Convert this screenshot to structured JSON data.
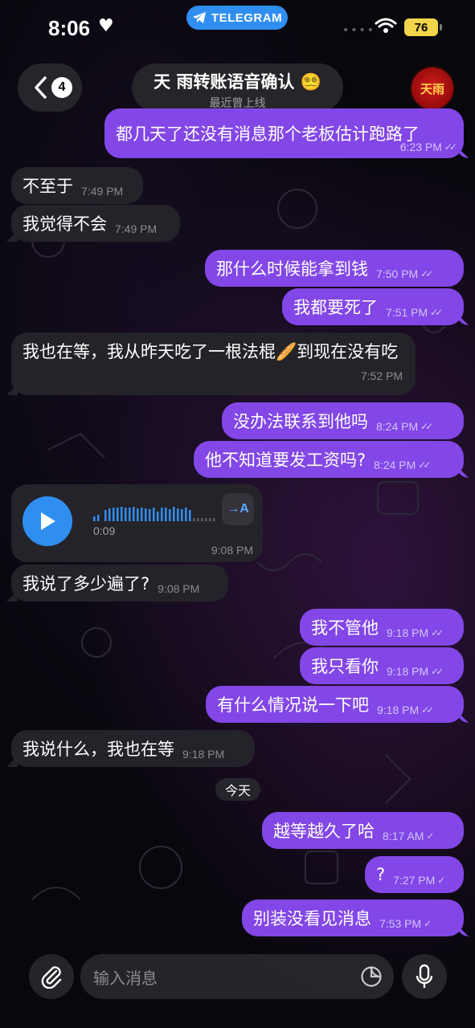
{
  "status_bar": {
    "time": "8:06",
    "app_pill": "TELEGRAM",
    "battery": "76"
  },
  "header": {
    "back_count": "4",
    "title": "天 雨转账语音确认",
    "title_emoji": "😵‍💫",
    "subtitle": "最近曾上线",
    "avatar_text": "天雨"
  },
  "messages": [
    {
      "dir": "out",
      "text": "都几天了还没有消息那个老板估计跑路了",
      "time": "6:23 PM",
      "read": true
    },
    {
      "dir": "in",
      "text": "不至于",
      "time": "7:49 PM"
    },
    {
      "dir": "in",
      "text": "我觉得不会",
      "time": "7:49 PM"
    },
    {
      "dir": "out",
      "text": "那什么时候能拿到钱",
      "time": "7:50 PM",
      "read": true
    },
    {
      "dir": "out",
      "text": "我都要死了",
      "time": "7:51 PM",
      "read": true
    },
    {
      "dir": "in",
      "text": "我也在等，我从昨天吃了一根法棍🥖到现在没有吃",
      "time": "7:52 PM"
    },
    {
      "dir": "out",
      "text": "没办法联系到他吗",
      "time": "8:24 PM",
      "read": true
    },
    {
      "dir": "out",
      "text": "他不知道要发工资吗?",
      "time": "8:24 PM",
      "read": true
    },
    {
      "dir": "in",
      "type": "voice",
      "duration": "0:09",
      "time": "9:08 PM",
      "transcribe_label": "→A"
    },
    {
      "dir": "in",
      "text": "我说了多少遍了?",
      "time": "9:08 PM"
    },
    {
      "dir": "out",
      "text": "我不管他",
      "time": "9:18 PM",
      "read": true
    },
    {
      "dir": "out",
      "text": "我只看你",
      "time": "9:18 PM",
      "read": true
    },
    {
      "dir": "out",
      "text": "有什么情况说一下吧",
      "time": "9:18 PM",
      "read": true
    },
    {
      "dir": "in",
      "text": "我说什么，我也在等",
      "time": "9:18 PM"
    },
    {
      "type": "date",
      "text": "今天"
    },
    {
      "dir": "out",
      "text": "越等越久了哈",
      "time": "8:17 AM",
      "read": false
    },
    {
      "dir": "out",
      "text": "?",
      "time": "7:27 PM",
      "read": false
    },
    {
      "dir": "out",
      "text": "别装没看见消息",
      "time": "7:53 PM",
      "read": false
    }
  ],
  "composer": {
    "placeholder": "输入消息"
  },
  "colors": {
    "outgoing": "#8247e6",
    "incoming": "#242329",
    "accent": "#2f8ef0"
  },
  "icons": [
    "heart-icon",
    "telegram-icon",
    "wifi-icon",
    "battery-icon",
    "back-chevron-icon",
    "play-icon",
    "paperclip-icon",
    "sticker-icon",
    "microphone-icon",
    "double-check-icon",
    "single-check-icon"
  ]
}
